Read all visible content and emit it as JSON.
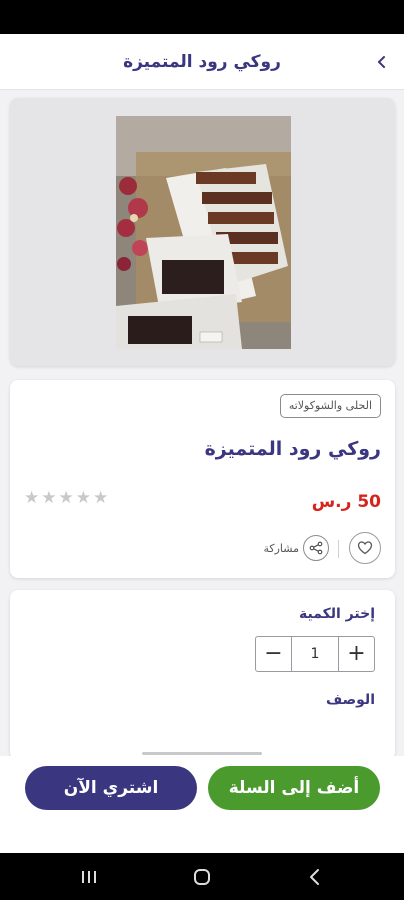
{
  "header": {
    "title": "روكي رود المتميزة",
    "back_icon": "chevron-left-icon"
  },
  "product": {
    "category": "الحلى والشوكولاته",
    "title": "روكي رود المتميزة",
    "price": "50 ر.س",
    "rating": 0,
    "rating_max": 5,
    "share_label": "مشاركة",
    "share_icon": "share-icon",
    "favorite_icon": "heart-icon",
    "image": "product-photo"
  },
  "quantity": {
    "label": "إختر الكمية",
    "value": "1",
    "minus": "−",
    "plus": "+"
  },
  "description": {
    "label": "الوصف"
  },
  "actions": {
    "add_to_cart": "أضف إلى السلة",
    "buy_now": "اشتري الآن"
  },
  "colors": {
    "primary": "#3a3680",
    "accent_green": "#4a9a2e",
    "price_red": "#d6241c"
  }
}
